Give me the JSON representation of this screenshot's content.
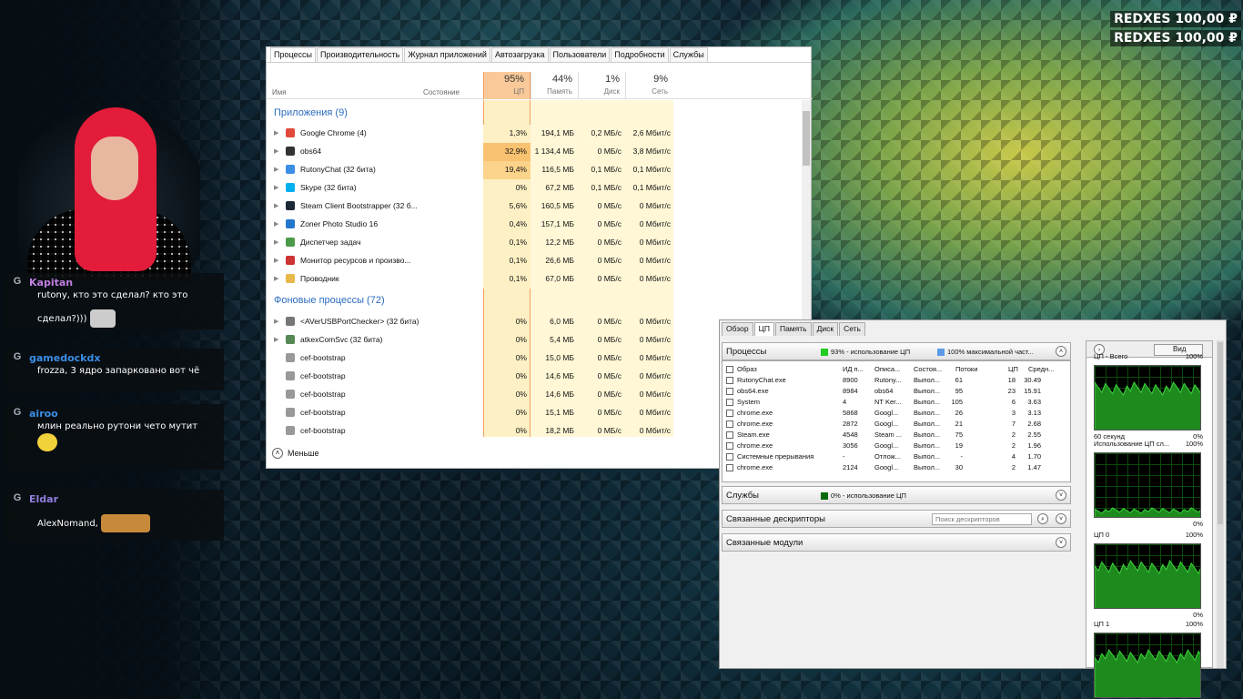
{
  "donations": [
    "REDXES 100,00 ₽",
    "REDXES 100,00 ₽"
  ],
  "chat": [
    {
      "nick": "Kapitan",
      "color": "#c07fe0",
      "lines": [
        "rutony, кто это сделал? кто это",
        "сделал?)))"
      ]
    },
    {
      "nick": "gamedockdx",
      "color": "#3a8ee6",
      "lines": [
        "frozza, 3 ядро запарковано вот чё"
      ]
    },
    {
      "nick": "airoo",
      "color": "#3a8ee6",
      "lines": [
        "млин реально рутони чето мутит"
      ]
    },
    {
      "nick": "Eldar",
      "color": "#8f7fe0",
      "lines": [
        "AlexNomand,"
      ]
    }
  ],
  "taskmgr": {
    "tabs": [
      "Процессы",
      "Производительность",
      "Журнал приложений",
      "Автозагрузка",
      "Пользователи",
      "Подробности",
      "Службы"
    ],
    "header": {
      "name": "Имя",
      "state": "Состояние",
      "cpu_pct": "95%",
      "cpu_lbl": "ЦП",
      "mem_pct": "44%",
      "mem_lbl": "Память",
      "disk_pct": "1%",
      "disk_lbl": "Диск",
      "net_pct": "9%",
      "net_lbl": "Сеть"
    },
    "apps_title": "Приложения (9)",
    "apps": [
      {
        "name": "Google Chrome (4)",
        "cpu": "1,3%",
        "mem": "194,1 МБ",
        "disk": "0,2 МБ/с",
        "net": "2,6 Мбит/с",
        "icon": "#e14a3b",
        "hl": "#fdf0c4"
      },
      {
        "name": "obs64",
        "cpu": "32,9%",
        "mem": "1 134,4 МБ",
        "disk": "0 МБ/с",
        "net": "3,8 Мбит/с",
        "icon": "#333333",
        "hl": "#f9c270"
      },
      {
        "name": "RutonyChat (32 бита)",
        "cpu": "19,4%",
        "mem": "116,5 МБ",
        "disk": "0,1 МБ/с",
        "net": "0,1 Мбит/с",
        "icon": "#3a8ee6",
        "hl": "#fbd38a"
      },
      {
        "name": "Skype (32 бита)",
        "cpu": "0%",
        "mem": "67,2 МБ",
        "disk": "0,1 МБ/с",
        "net": "0,1 Мбит/с",
        "icon": "#00aff0",
        "hl": "#fdf0c4"
      },
      {
        "name": "Steam Client Bootstrapper (32 б...",
        "cpu": "5,6%",
        "mem": "160,5 МБ",
        "disk": "0 МБ/с",
        "net": "0 Мбит/с",
        "icon": "#1b2838",
        "hl": "#fdf0c4"
      },
      {
        "name": "Zoner Photo Studio 16",
        "cpu": "0,4%",
        "mem": "157,1 МБ",
        "disk": "0 МБ/с",
        "net": "0 Мбит/с",
        "icon": "#2277cc",
        "hl": "#fdf0c4"
      },
      {
        "name": "Диспетчер задач",
        "cpu": "0,1%",
        "mem": "12,2 МБ",
        "disk": "0 МБ/с",
        "net": "0 Мбит/с",
        "icon": "#4a9a4a",
        "hl": "#fdf0c4"
      },
      {
        "name": "Монитор ресурсов и произво...",
        "cpu": "0,1%",
        "mem": "26,6 МБ",
        "disk": "0 МБ/с",
        "net": "0 Мбит/с",
        "icon": "#cc3333",
        "hl": "#fdf0c4"
      },
      {
        "name": "Проводник",
        "cpu": "0,1%",
        "mem": "67,0 МБ",
        "disk": "0 МБ/с",
        "net": "0 Мбит/с",
        "icon": "#e8b84a",
        "hl": "#fdf0c4"
      }
    ],
    "bg_title": "Фоновые процессы (72)",
    "bg": [
      {
        "name": "<AVerUSBPortChecker> (32 бита)",
        "cpu": "0%",
        "mem": "6,0 МБ",
        "disk": "0 МБ/с",
        "net": "0 Мбит/с",
        "icon": "#777777"
      },
      {
        "name": "atkexComSvc (32 бита)",
        "cpu": "0%",
        "mem": "5,4 МБ",
        "disk": "0 МБ/с",
        "net": "0 Мбит/с",
        "icon": "#558855"
      },
      {
        "name": "cef-bootstrap",
        "cpu": "0%",
        "mem": "15,0 МБ",
        "disk": "0 МБ/с",
        "net": "0 Мбит/с",
        "icon": "#999999"
      },
      {
        "name": "cef-bootstrap",
        "cpu": "0%",
        "mem": "14,6 МБ",
        "disk": "0 МБ/с",
        "net": "0 Мбит/с",
        "icon": "#999999"
      },
      {
        "name": "cef-bootstrap",
        "cpu": "0%",
        "mem": "14,6 МБ",
        "disk": "0 МБ/с",
        "net": "0 Мбит/с",
        "icon": "#999999"
      },
      {
        "name": "cef-bootstrap",
        "cpu": "0%",
        "mem": "15,1 МБ",
        "disk": "0 МБ/с",
        "net": "0 Мбит/с",
        "icon": "#999999"
      },
      {
        "name": "cef-bootstrap",
        "cpu": "0%",
        "mem": "18,2 МБ",
        "disk": "0 МБ/с",
        "net": "0 Мбит/с",
        "icon": "#999999"
      }
    ],
    "fewer": "Меньше"
  },
  "resmon": {
    "tabs": [
      "Обзор",
      "ЦП",
      "Память",
      "Диск",
      "Сеть"
    ],
    "processes_title": "Процессы",
    "cpu_usage": "93% - использование ЦП",
    "max_freq": "100% максимальной част...",
    "columns": [
      "Образ",
      "ИД п...",
      "Описа...",
      "Состоя...",
      "Потоки",
      "ЦП",
      "Средн..."
    ],
    "rows": [
      [
        "RutonyChat.exe",
        "8900",
        "Rutony...",
        "Выпол...",
        "61",
        "18",
        "30.49"
      ],
      [
        "obs64.exe",
        "8984",
        "obs64",
        "Выпол...",
        "95",
        "23",
        "15.91"
      ],
      [
        "System",
        "4",
        "NT Ker...",
        "Выпол...",
        "105",
        "6",
        "3.63"
      ],
      [
        "chrome.exe",
        "5868",
        "Googl...",
        "Выпол...",
        "26",
        "3",
        "3.13"
      ],
      [
        "chrome.exe",
        "2872",
        "Googl...",
        "Выпол...",
        "21",
        "7",
        "2.68"
      ],
      [
        "Steam.exe",
        "4548",
        "Steam ...",
        "Выпол...",
        "75",
        "2",
        "2.55"
      ],
      [
        "chrome.exe",
        "3056",
        "Googl...",
        "Выпол...",
        "19",
        "2",
        "1.96"
      ],
      [
        "Системные прерывания",
        "-",
        "Отлож...",
        "Выпол...",
        "-",
        "4",
        "1.70"
      ],
      [
        "chrome.exe",
        "2124",
        "Googl...",
        "Выпол...",
        "30",
        "2",
        "1.47"
      ]
    ],
    "services_title": "Службы",
    "services_usage": "0% - использование ЦП",
    "handles_title": "Связанные дескрипторы",
    "handles_search": "Поиск дескрипторов",
    "modules_title": "Связанные модули",
    "view_label": "Вид",
    "graphs": [
      {
        "title": "ЦП - Всего",
        "max": "100%",
        "foot_left": "60 секунд",
        "foot_right": "0%"
      },
      {
        "title": "Использование ЦП сл...",
        "max": "100%",
        "foot_left": "",
        "foot_right": "0%"
      },
      {
        "title": "ЦП 0",
        "max": "100%",
        "foot_left": "",
        "foot_right": "0%"
      },
      {
        "title": "ЦП 1",
        "max": "100%",
        "foot_left": "",
        "foot_right": ""
      }
    ]
  }
}
